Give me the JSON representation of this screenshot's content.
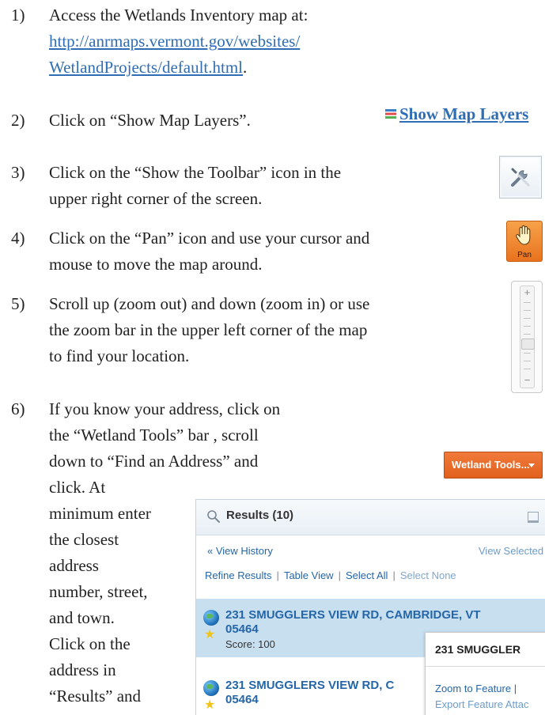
{
  "steps": [
    {
      "num": "1)",
      "lines": [
        "Access the Wetlands Inventory map at:"
      ],
      "link_lines": [
        "http://anrmaps.vermont.gov/websites/",
        "WetlandProjects/default.html"
      ],
      "link_suffix": "."
    },
    {
      "num": "2)",
      "lines": [
        "Click on “Show Map Layers”."
      ]
    },
    {
      "num": "3)",
      "lines": [
        "Click on the “Show the Toolbar” icon in the",
        "upper right corner of the screen."
      ]
    },
    {
      "num": "4)",
      "lines": [
        "Click on the “Pan” icon and use your cursor and",
        "mouse to move the map around."
      ]
    },
    {
      "num": "5)",
      "lines": [
        "Scroll up (zoom out) and down (zoom in) or use",
        "the zoom bar in the upper left corner of the map",
        "to find your location."
      ]
    },
    {
      "num": "6)",
      "lines": [
        "If you know your address, click on",
        "the “Wetland Tools” bar , scroll",
        "down to “Find an Address” and",
        "click. At",
        "minimum enter",
        "the closest",
        "address",
        "number, street,",
        "and town.",
        "Click on the",
        "address in",
        "“Results” and"
      ]
    }
  ],
  "widgets": {
    "show_map_layers": "Show Map Layers",
    "pan_label": "Pan",
    "wetland_tools": "Wetland Tools...",
    "zoom_plus": "+",
    "zoom_minus": "−"
  },
  "results_panel": {
    "title": "Results (10)",
    "view_history": "« View History",
    "view_selected": "View Selected",
    "refine_links": [
      "Refine Results",
      "Table View",
      "Select All",
      "Select None"
    ],
    "rows": [
      {
        "address": "231 SMUGGLERS VIEW RD, CAMBRIDGE, VT",
        "zip": "05464",
        "score": "Score: 100"
      },
      {
        "address": "231 SMUGGLERS VIEW RD, C",
        "zip": "05464"
      }
    ],
    "popup": {
      "title": "231 SMUGGLER",
      "zoom_to_feature": "Zoom to Feature |",
      "export": "Export Feature Attac"
    }
  }
}
